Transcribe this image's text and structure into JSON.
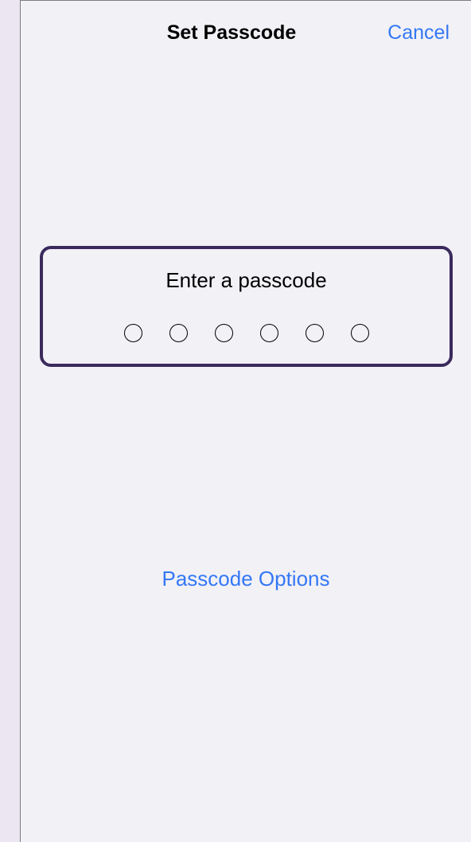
{
  "nav": {
    "title": "Set Passcode",
    "cancel_label": "Cancel"
  },
  "passcode": {
    "prompt": "Enter a passcode",
    "digits_total": 6,
    "digits_entered": 0
  },
  "options_label": "Passcode Options",
  "colors": {
    "accent": "#3478f6",
    "focus_border": "#3a2a5c",
    "background": "#f2f1f6"
  }
}
